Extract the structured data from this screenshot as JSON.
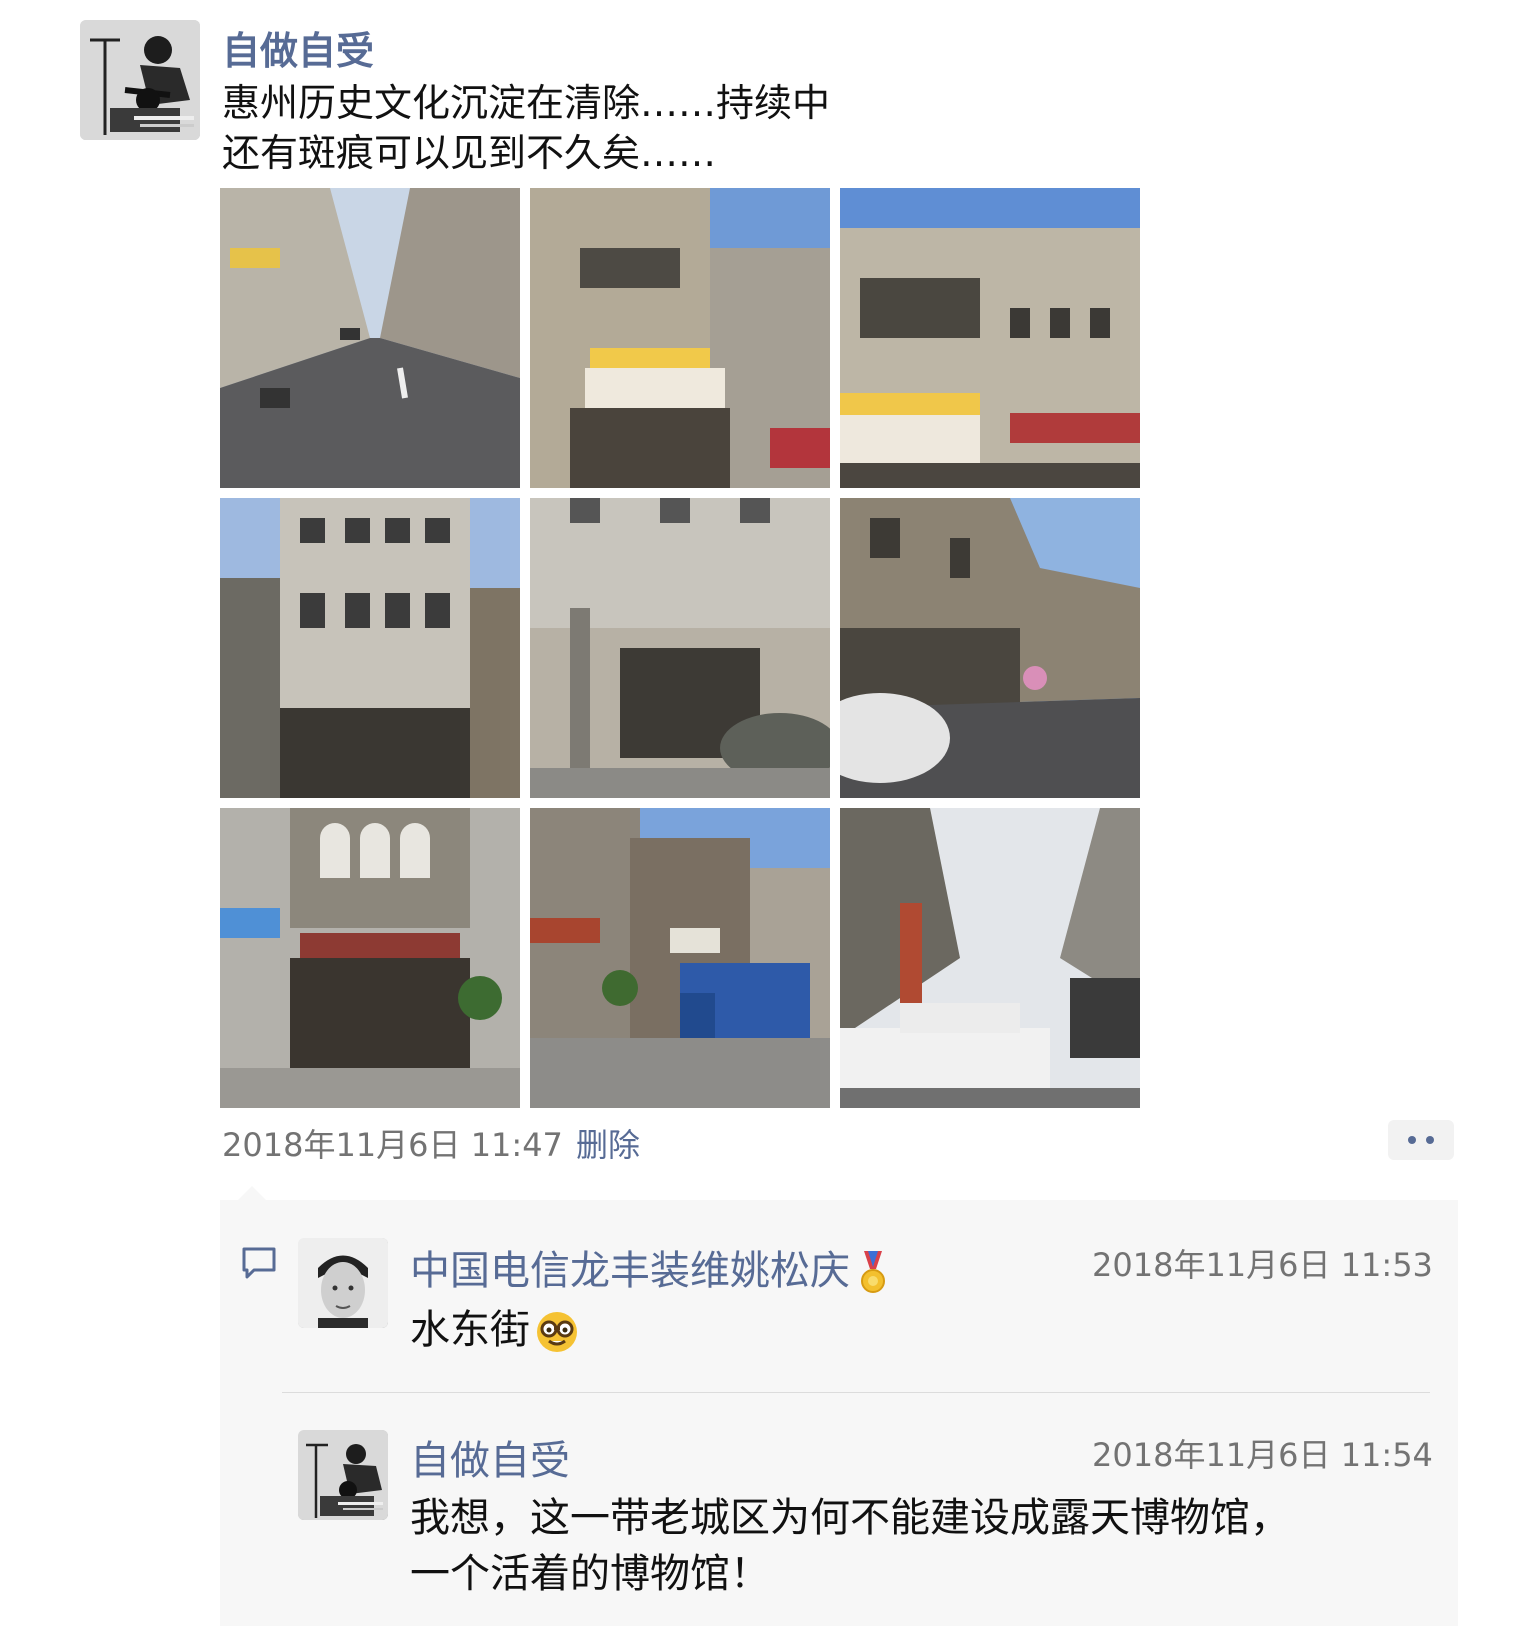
{
  "post": {
    "author": "自做自受",
    "text_line1": "惠州历史文化沉淀在清除……持续中",
    "text_line2": "还有斑痕可以见到不久矣……",
    "timestamp": "2018年11月6日 11:47",
    "delete_label": "删除",
    "photo_count": 9
  },
  "comments": [
    {
      "author": "中国电信龙丰装维姚松庆",
      "badge_icon": "medal-icon",
      "time": "2018年11月6日 11:53",
      "text": "水东街",
      "emoji_icon": "nerd-face-emoji-icon"
    },
    {
      "author": "自做自受",
      "time": "2018年11月6日 11:54",
      "text_line1": "我想，这一带老城区为何不能建设成露天博物馆，",
      "text_line2": "一个活着的博物馆！"
    }
  ],
  "icons": {
    "more": "more-dots-icon",
    "comment": "comment-bubble-icon"
  },
  "colors": {
    "link": "#576b95",
    "meta": "#737373",
    "comment_bg": "#f7f7f7"
  }
}
